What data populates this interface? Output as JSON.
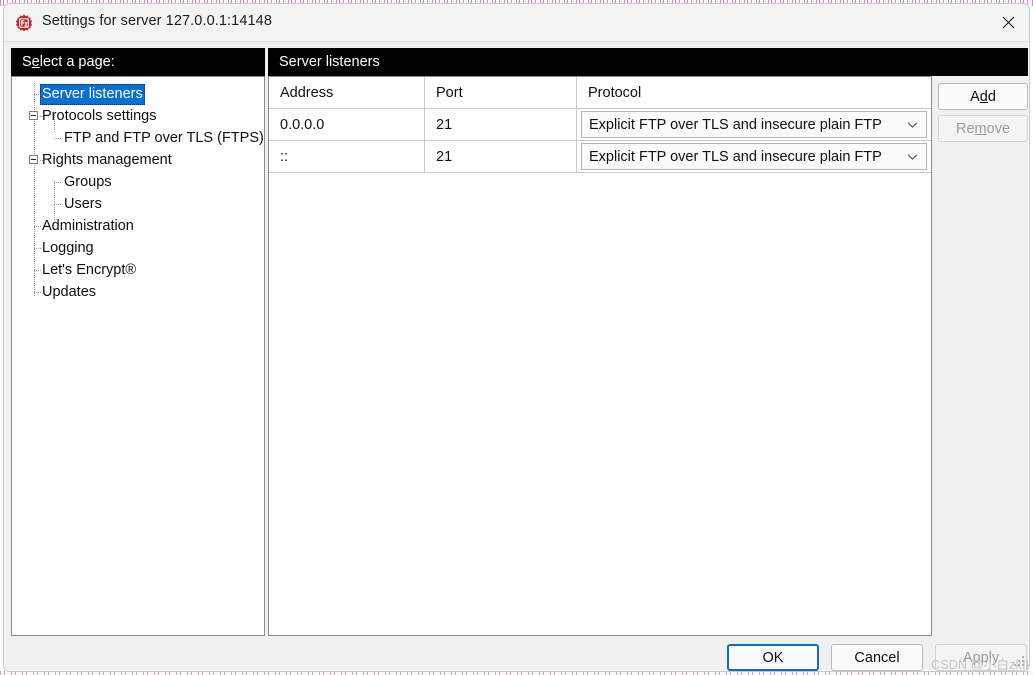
{
  "window": {
    "title": "Settings for server 127.0.0.1:14148",
    "icon": "filezilla-server-icon",
    "close_label": "close-icon"
  },
  "sidebar": {
    "header": "Select a page:",
    "header_accel": "e",
    "items": [
      {
        "label": "Server listeners",
        "level": 1,
        "selected": true,
        "expander": "none"
      },
      {
        "label": "Protocols settings",
        "level": 1,
        "selected": false,
        "expander": "minus"
      },
      {
        "label": "FTP and FTP over TLS (FTPS)",
        "level": 2,
        "selected": false,
        "expander": "none"
      },
      {
        "label": "Rights management",
        "level": 1,
        "selected": false,
        "expander": "minus"
      },
      {
        "label": "Groups",
        "level": 2,
        "selected": false,
        "expander": "none"
      },
      {
        "label": "Users",
        "level": 2,
        "selected": false,
        "expander": "none"
      },
      {
        "label": "Administration",
        "level": 1,
        "selected": false,
        "expander": "none"
      },
      {
        "label": "Logging",
        "level": 1,
        "selected": false,
        "expander": "none"
      },
      {
        "label": "Let's Encrypt®",
        "level": 1,
        "selected": false,
        "expander": "none"
      },
      {
        "label": "Updates",
        "level": 1,
        "selected": false,
        "expander": "none"
      }
    ]
  },
  "main": {
    "header": "Server listeners",
    "table": {
      "columns": [
        "Address",
        "Port",
        "Protocol"
      ],
      "rows": [
        {
          "address": "0.0.0.0",
          "port": "21",
          "protocol": "Explicit FTP over TLS and insecure plain FTP"
        },
        {
          "address": "::",
          "port": "21",
          "protocol": "Explicit FTP over TLS and insecure plain FTP"
        }
      ]
    },
    "side_buttons": {
      "add": "Add",
      "add_accel": "d",
      "remove": "Remove",
      "remove_accel": "m",
      "remove_disabled": true
    }
  },
  "footer": {
    "ok": "OK",
    "cancel": "Cancel",
    "apply": "Apply",
    "apply_disabled": true,
    "watermark": "CSDN @小白zkIk"
  },
  "colors": {
    "selection": "#0a6fd4",
    "header_band": "#000000",
    "dialog_bg": "#f0f0f0",
    "panel_bg": "#ffffff",
    "brand_red": "#c0272d"
  }
}
